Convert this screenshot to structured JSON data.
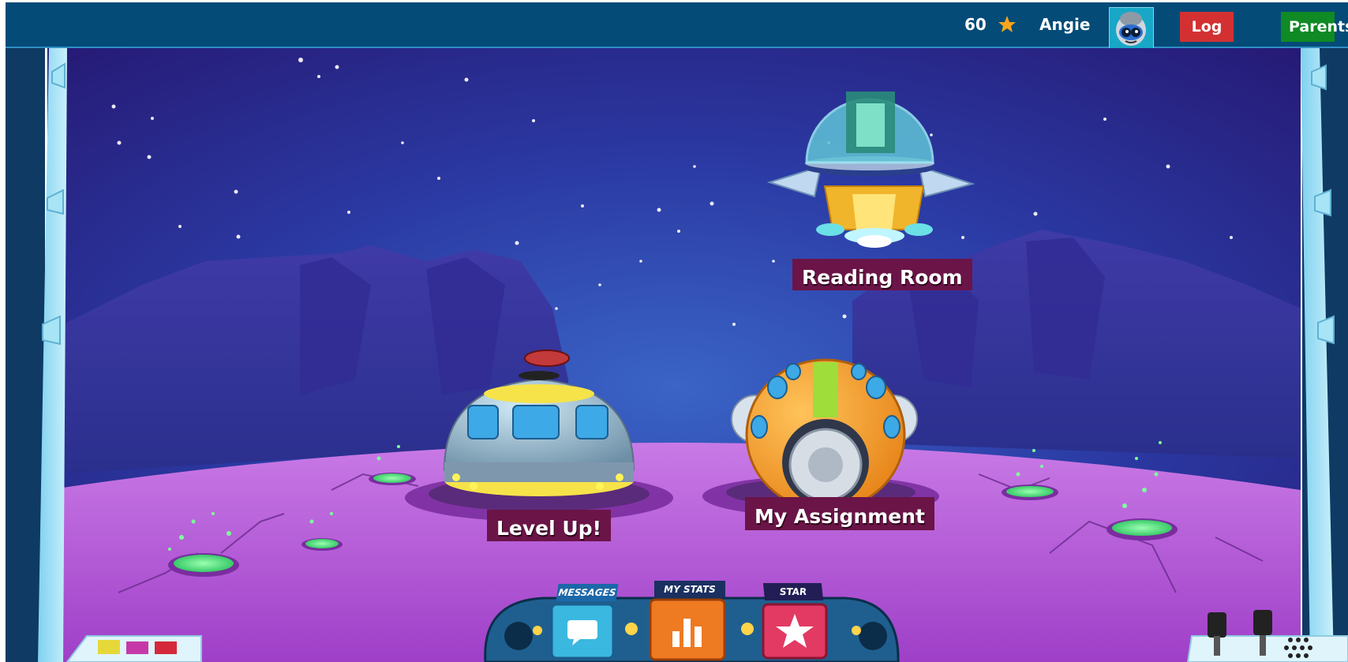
{
  "topbar": {
    "stars": "60",
    "username": "Angie",
    "logout_label": "Log Out",
    "parents_label": "Parents"
  },
  "places": {
    "reading_room": "Reading Room",
    "level_up": "Level Up!",
    "my_assignment": "My Assignment"
  },
  "console": {
    "messages_label": "MESSAGES",
    "stats_label": "MY STATS",
    "starzone_label": "STAR ZONE"
  },
  "icons": {
    "star": "star-icon",
    "avatar": "robot-avatar",
    "messages": "chat-bubble-icon",
    "stats": "bar-chart-icon",
    "starzone": "star-icon"
  },
  "colors": {
    "topbar": "#044b78",
    "logout": "#d33131",
    "parents": "#0f8a24",
    "label_bg": "#6b1447",
    "sky": "#2a2e8f",
    "ground": "#b45bd6"
  }
}
